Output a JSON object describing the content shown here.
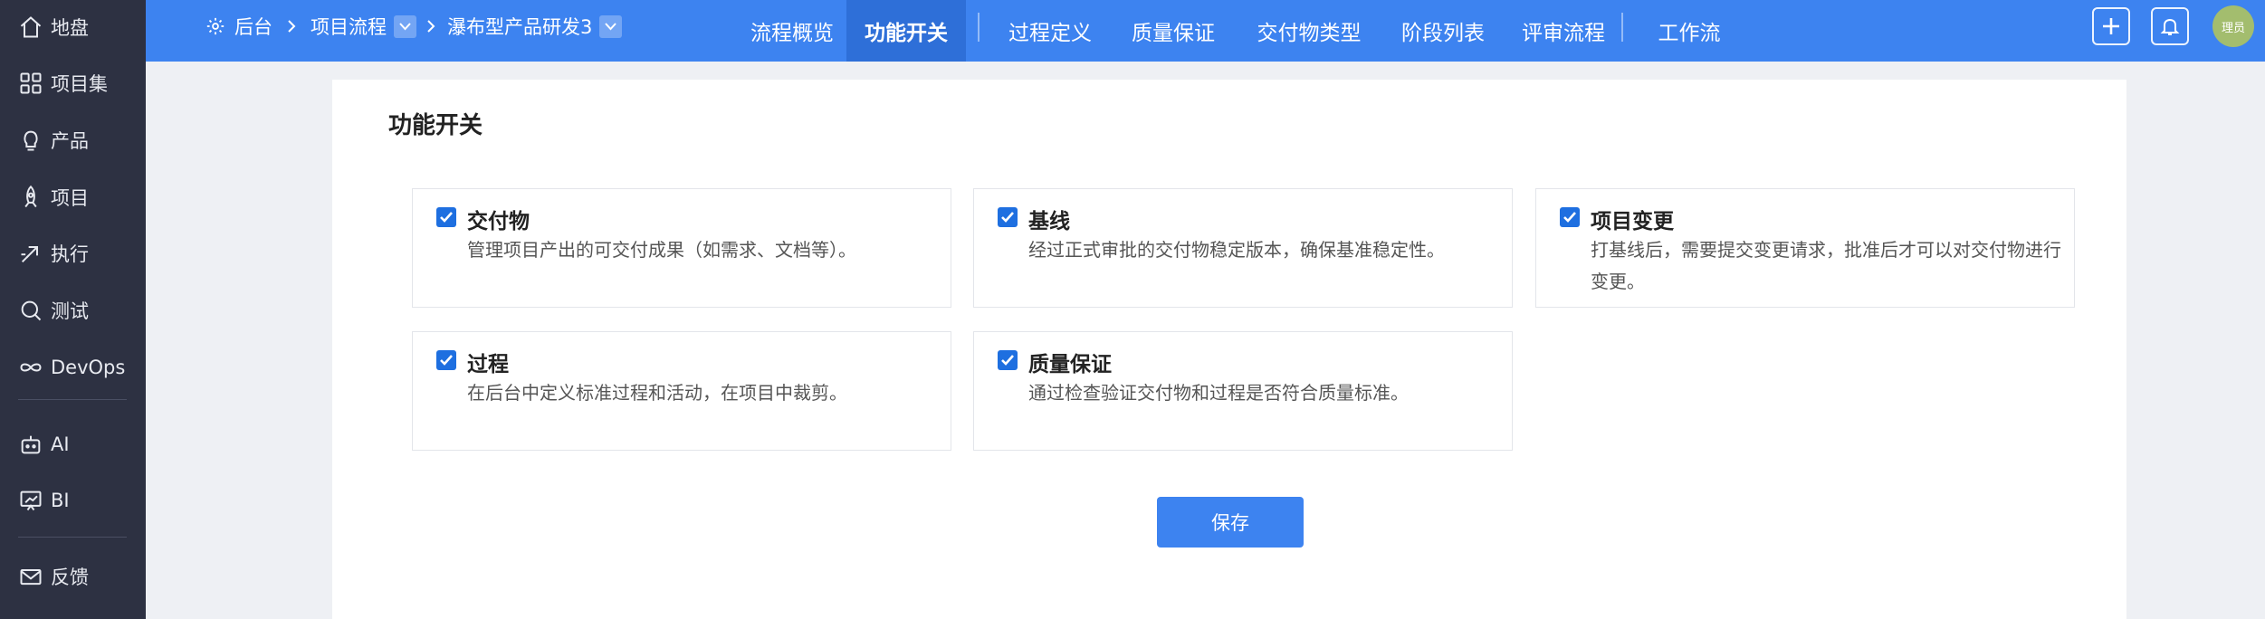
{
  "sidebar": {
    "items": [
      {
        "label": "地盘",
        "icon": "home-icon"
      },
      {
        "label": "项目集",
        "icon": "grid-icon"
      },
      {
        "label": "产品",
        "icon": "lightbulb-icon"
      },
      {
        "label": "项目",
        "icon": "rocket-icon"
      },
      {
        "label": "执行",
        "icon": "sprint-icon"
      },
      {
        "label": "测试",
        "icon": "magnifier-icon"
      },
      {
        "label": "DevOps",
        "icon": "infinity-icon"
      },
      {
        "label": "AI",
        "icon": "robot-icon"
      },
      {
        "label": "BI",
        "icon": "chart-board-icon"
      },
      {
        "label": "反馈",
        "icon": "envelope-icon"
      }
    ]
  },
  "header": {
    "breadcrumb": {
      "root": "后台",
      "level1": "项目流程",
      "level2": "瀑布型产品研发3"
    },
    "tabs": [
      {
        "label": "流程概览"
      },
      {
        "label": "功能开关",
        "active": true
      },
      {
        "label": "过程定义"
      },
      {
        "label": "质量保证"
      },
      {
        "label": "交付物类型"
      },
      {
        "label": "阶段列表"
      },
      {
        "label": "评审流程"
      },
      {
        "label": "工作流"
      }
    ],
    "avatar_text": "理员"
  },
  "main": {
    "title": "功能开关",
    "features": [
      {
        "title": "交付物",
        "desc": "管理项目产出的可交付成果（如需求、文档等）。",
        "checked": true
      },
      {
        "title": "基线",
        "desc": "经过正式审批的交付物稳定版本，确保基准稳定性。",
        "checked": true
      },
      {
        "title": "项目变更",
        "desc": "打基线后，需要提交变更请求，批准后才可以对交付物进行变更。",
        "checked": true
      },
      {
        "title": "过程",
        "desc": "在后台中定义标准过程和活动，在项目中裁剪。",
        "checked": true
      },
      {
        "title": "质量保证",
        "desc": "通过检查验证交付物和过程是否符合质量标准。",
        "checked": true
      }
    ],
    "save_label": "保存"
  },
  "colors": {
    "topbar": "#3d83f0",
    "active_tab": "#2e6fd8",
    "sidebar": "#2d3142",
    "checkbox": "#1e6fe0",
    "avatar": "#a3bd6e"
  }
}
